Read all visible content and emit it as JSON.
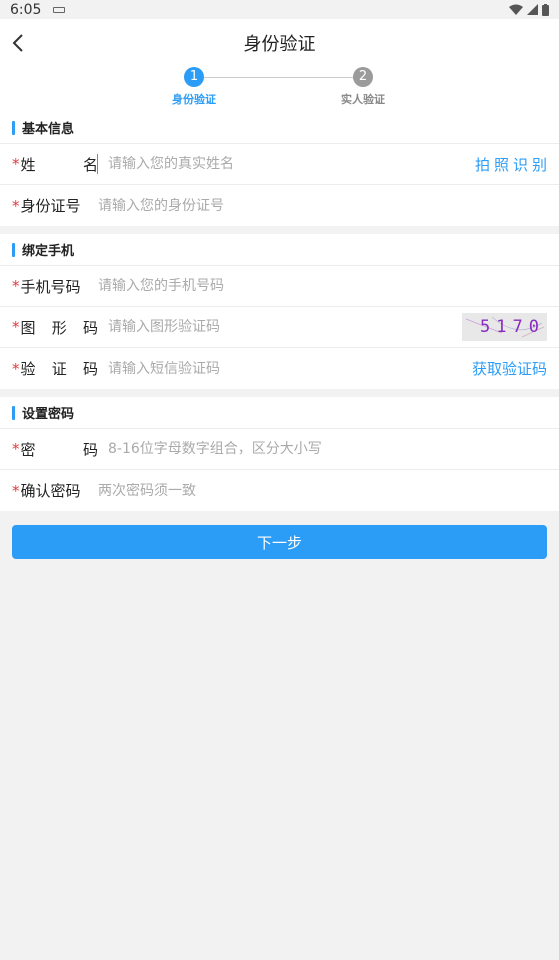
{
  "statusbar": {
    "time": "6:05"
  },
  "header": {
    "title": "身份验证"
  },
  "steps": [
    {
      "num": "1",
      "label": "身份验证"
    },
    {
      "num": "2",
      "label": "实人验证"
    }
  ],
  "sections": {
    "basic": {
      "title": "基本信息",
      "name": {
        "label_a": "姓",
        "label_b": "名",
        "placeholder": "请输入您的真实姓名",
        "action": "拍照识别"
      },
      "idcard": {
        "label": "身份证号",
        "placeholder": "请输入您的身份证号"
      }
    },
    "phone": {
      "title": "绑定手机",
      "mobile": {
        "label": "手机号码",
        "placeholder": "请输入您的手机号码"
      },
      "captcha": {
        "label_a": "图",
        "label_b": "形",
        "label_c": "码",
        "placeholder": "请输入图形验证码",
        "code": "5170"
      },
      "sms": {
        "label_a": "验",
        "label_b": "证",
        "label_c": "码",
        "placeholder": "请输入短信验证码",
        "action": "获取验证码"
      }
    },
    "password": {
      "title": "设置密码",
      "pwd": {
        "label_a": "密",
        "label_b": "码",
        "placeholder": "8-16位字母数字组合，区分大小写"
      },
      "confirm": {
        "label": "确认密码",
        "placeholder": "两次密码须一致"
      }
    }
  },
  "required_mark": "*",
  "next_button": "下一步"
}
